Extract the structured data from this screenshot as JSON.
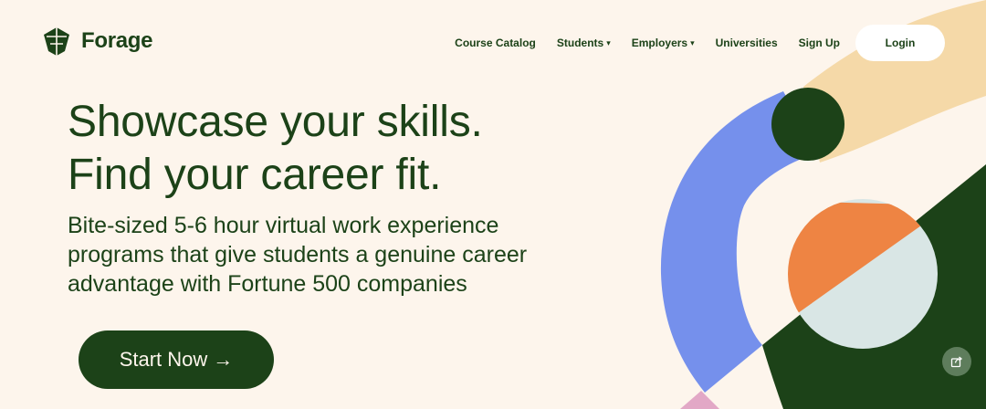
{
  "brand": {
    "name": "Forage"
  },
  "nav": {
    "items": [
      {
        "label": "Course Catalog",
        "has_dropdown": false
      },
      {
        "label": "Students",
        "has_dropdown": true
      },
      {
        "label": "Employers",
        "has_dropdown": true
      },
      {
        "label": "Universities",
        "has_dropdown": false
      },
      {
        "label": "Sign Up",
        "has_dropdown": false
      }
    ],
    "dropdown_glyph": "▾",
    "login_label": "Login"
  },
  "hero": {
    "headline_line1": "Showcase your skills.",
    "headline_line2": "Find your career fit.",
    "subhead": "Bite-sized 5-6 hour virtual work experience programs that give students a genuine career advantage with Fortune 500 companies",
    "cta_label": "Start Now",
    "cta_arrow": "→"
  },
  "icons": {
    "share": "share-icon",
    "logo": "forage-logo-icon"
  },
  "colors": {
    "background": "#fdf5ec",
    "brand_green": "#1c4218",
    "blue": "#7590ec",
    "peach": "#f5d9a8",
    "orange": "#ee8443",
    "pale_blue": "#d9e6e5",
    "pink": "#e2a8c6"
  }
}
